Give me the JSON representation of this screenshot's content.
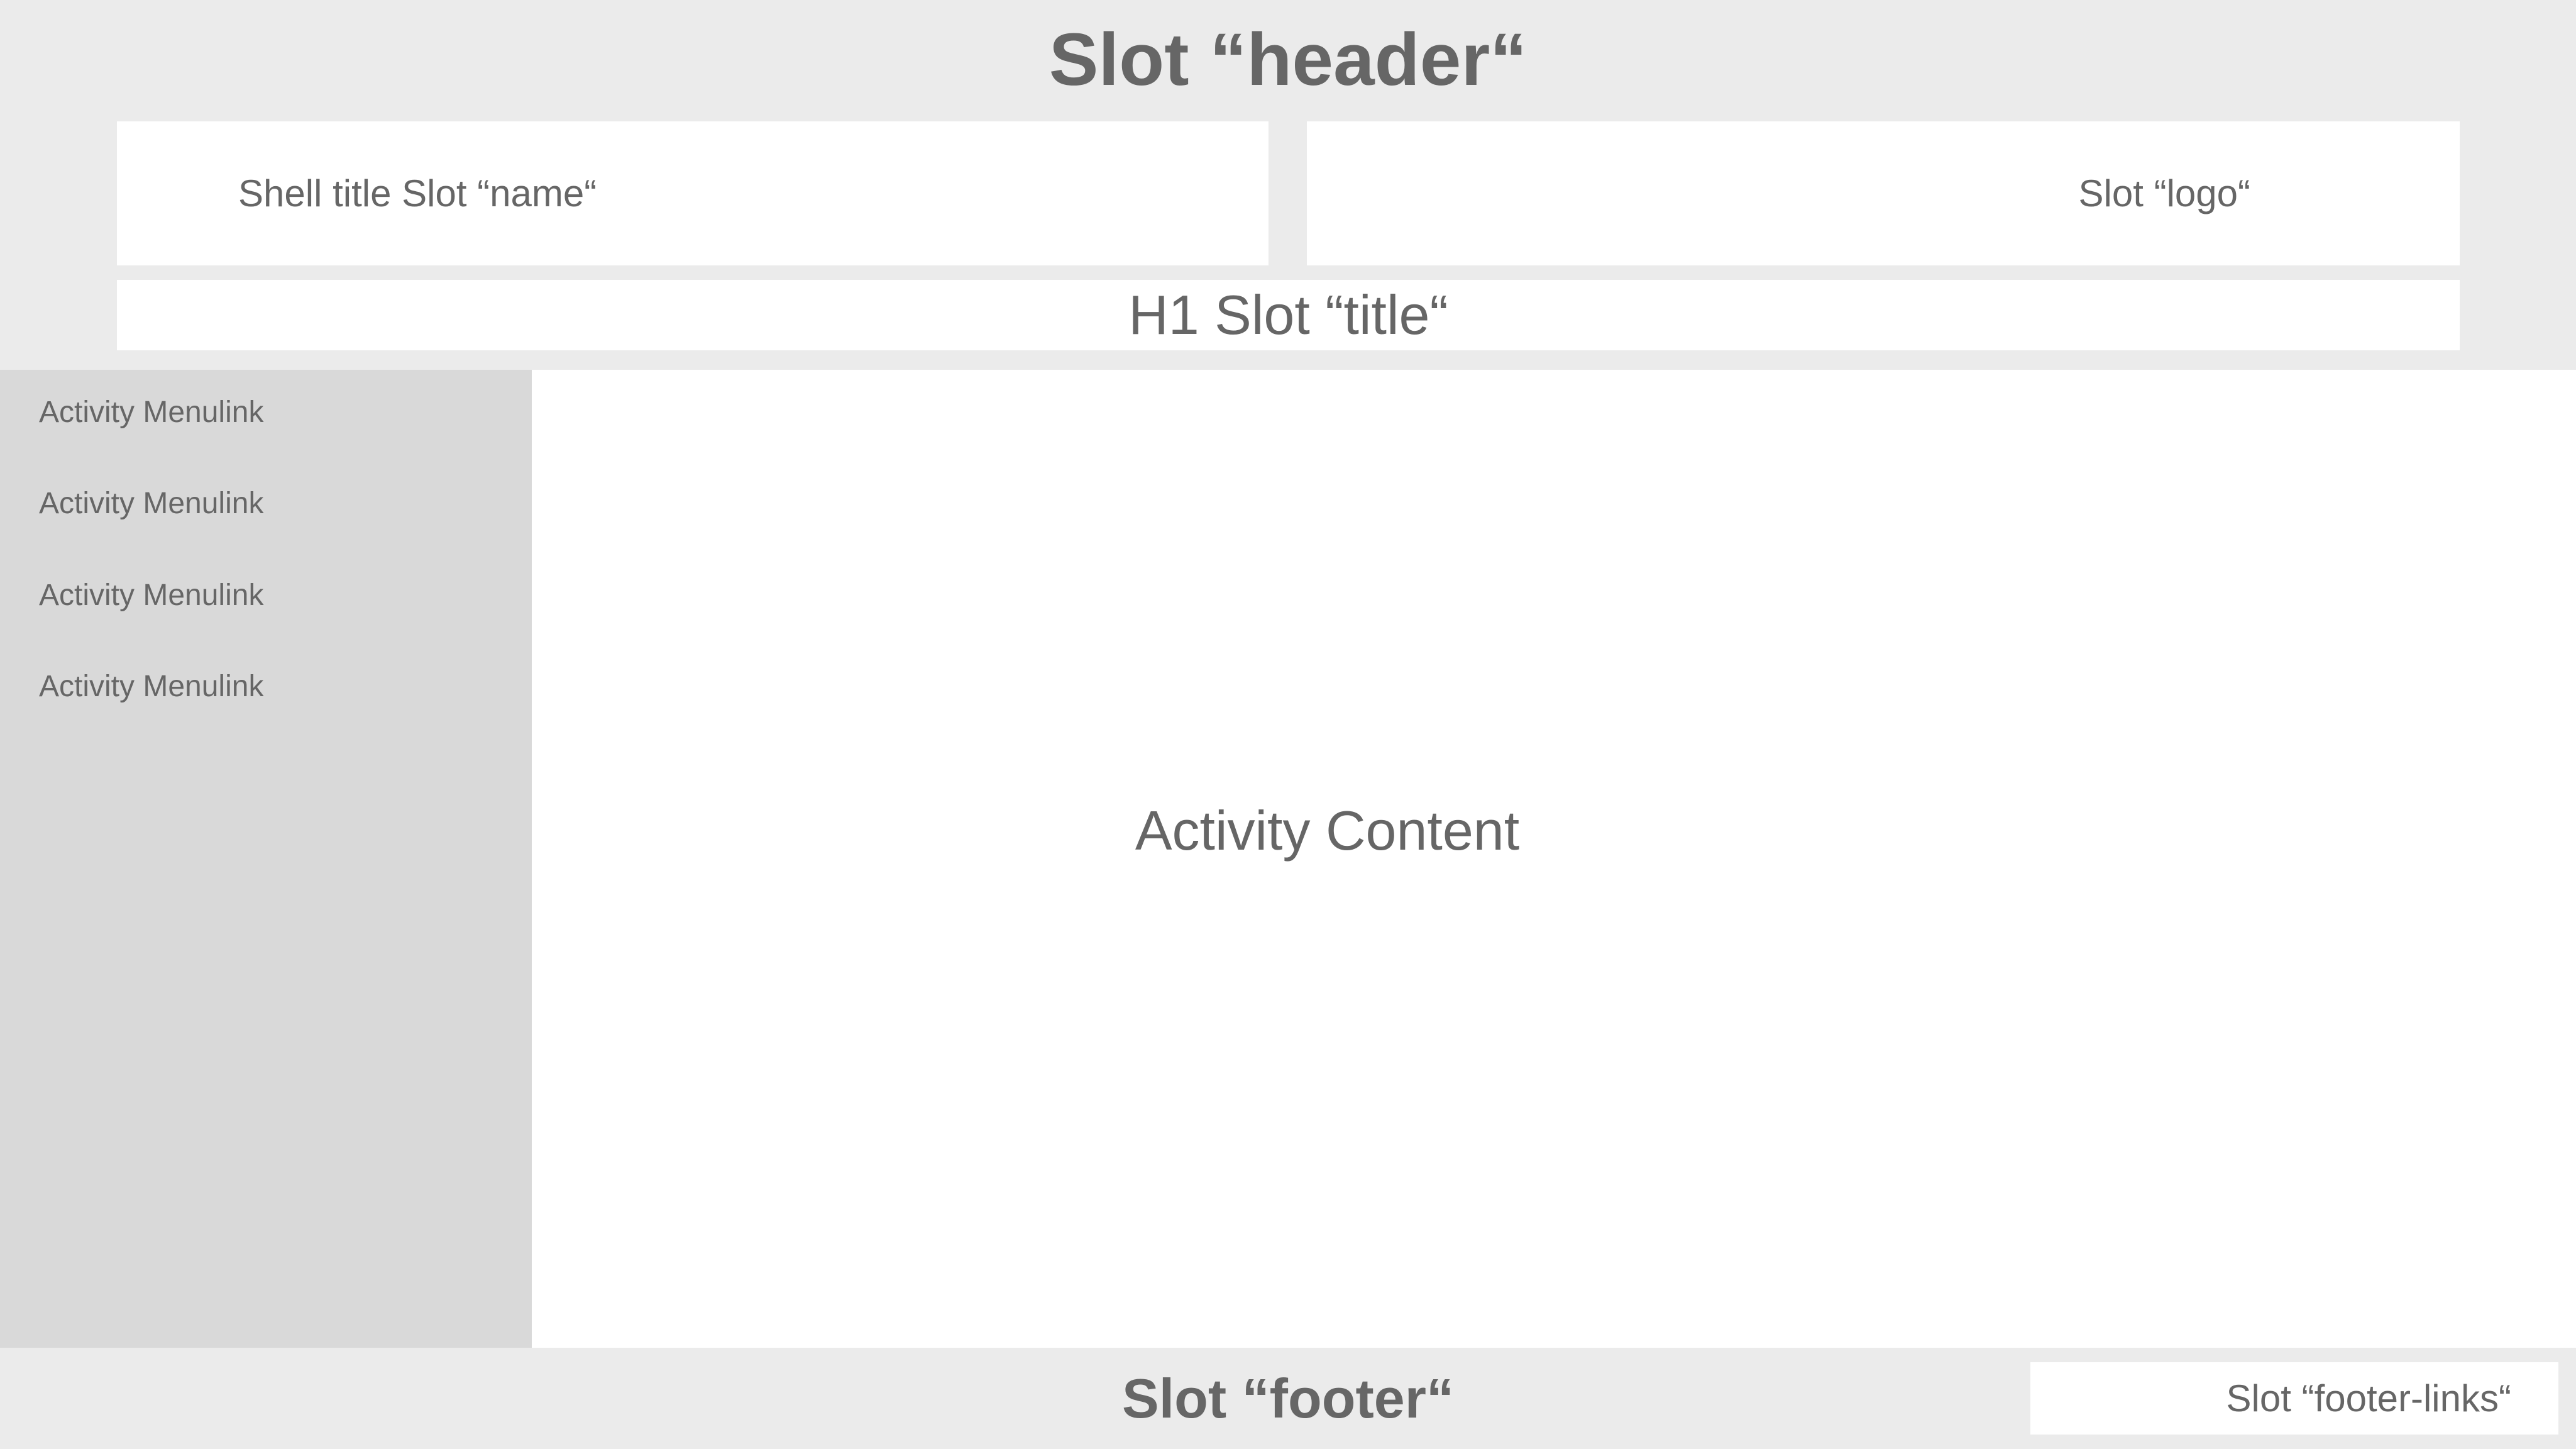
{
  "header": {
    "label": "Slot “header“",
    "name_slot": "Shell title Slot “name“",
    "logo_slot": "Slot “logo“",
    "title_slot": "H1 Slot “title“"
  },
  "sidebar": {
    "items": [
      {
        "label": "Activity Menulink"
      },
      {
        "label": "Activity Menulink"
      },
      {
        "label": "Activity Menulink"
      },
      {
        "label": "Activity Menulink"
      }
    ]
  },
  "main": {
    "content_label": "Activity Content"
  },
  "footer": {
    "label": "Slot “footer“",
    "links_slot": "Slot “footer-links“"
  },
  "colors": {
    "header_background": "#ebebeb",
    "sidebar_background": "#d9d9d9",
    "slot_background": "#ffffff",
    "text": "#666666"
  }
}
